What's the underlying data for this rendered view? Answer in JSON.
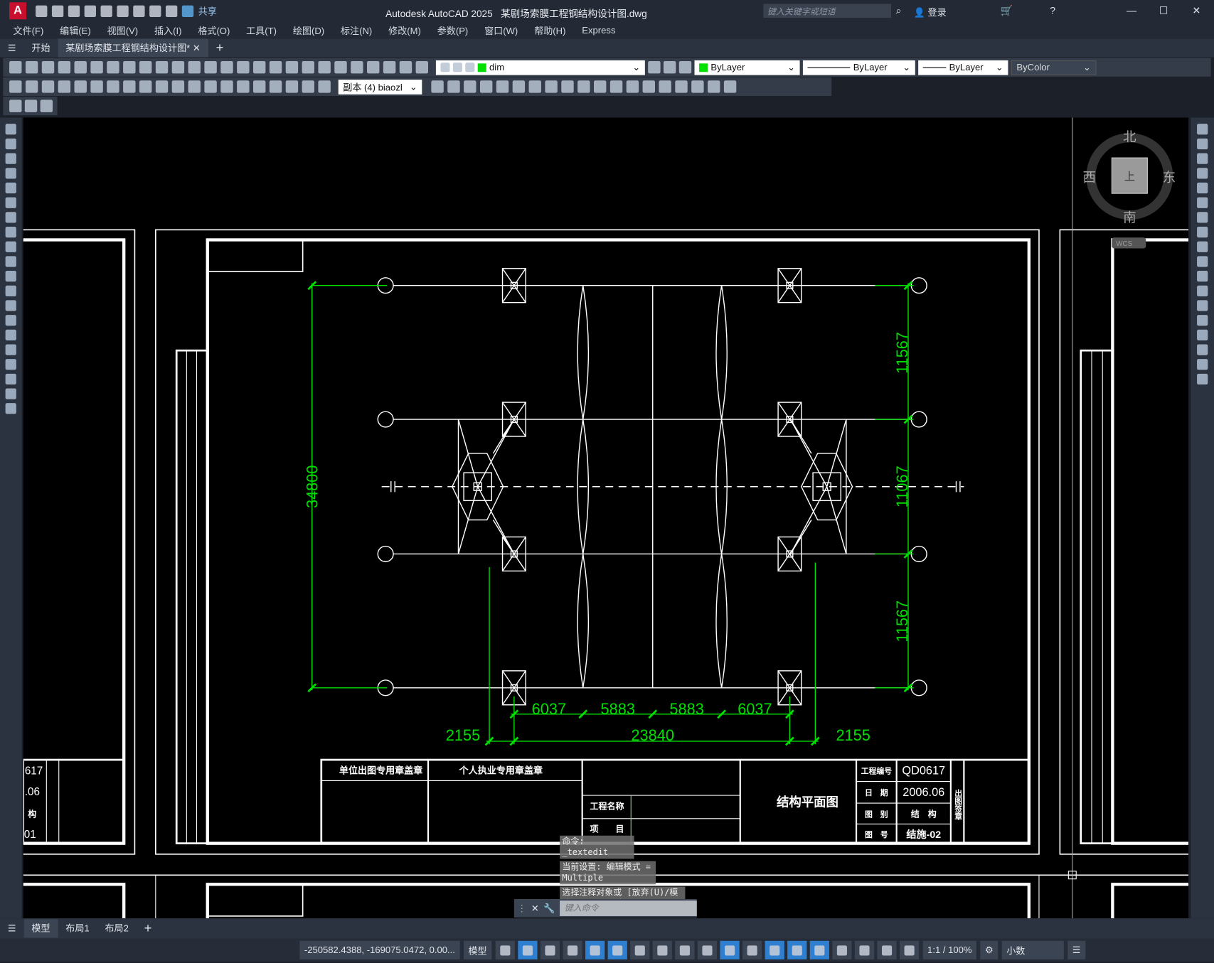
{
  "app": {
    "title": "Autodesk AutoCAD 2025",
    "file": "某剧场索膜工程钢结构设计图.dwg",
    "share": "共享",
    "search_placeholder": "键入关键字或短语",
    "login": "登录",
    "logo": "A"
  },
  "menu": [
    "文件(F)",
    "编辑(E)",
    "视图(V)",
    "插入(I)",
    "格式(O)",
    "工具(T)",
    "绘图(D)",
    "标注(N)",
    "修改(M)",
    "参数(P)",
    "窗口(W)",
    "帮助(H)",
    "Express"
  ],
  "tabs": {
    "start": "开始",
    "active": "某剧场索膜工程钢结构设计图*"
  },
  "toolbar": {
    "layer": "dim",
    "color": "ByLayer",
    "linetype": "ByLayer",
    "lineweight": "ByLayer",
    "plotstyle": "ByColor",
    "dimstyle": "副本 (4) biaozl"
  },
  "drawing": {
    "dims_vertical": {
      "total": "34800",
      "segments": [
        "11567",
        "11067",
        "11567"
      ]
    },
    "dims_bottom_top": [
      "6037",
      "5883",
      "5883",
      "6037"
    ],
    "dims_bottom": [
      "2155",
      "23840",
      "2155"
    ],
    "title_block": {
      "unit_stamp": "单位出图专用章盖章",
      "personal_stamp": "个人执业专用章盖章",
      "project_name_label": "工程名称",
      "item_label": "项　　目",
      "drawing_title": "结构平面图",
      "project_no_label": "工程编号",
      "project_no": "QD0617",
      "date_label": "日　期",
      "date": "2006.06",
      "category_label": "图　别",
      "category": "结　构",
      "drawing_no_label": "图　号",
      "drawing_no": "结施-02",
      "out_stamp": "出图签章"
    },
    "left_partial": [
      "617",
      ".06",
      "构",
      "01"
    ],
    "compass": {
      "north": "北",
      "south": "南",
      "east": "东",
      "west": "西",
      "wcs": "WCS",
      "top": "上"
    }
  },
  "command": {
    "history": [
      "命令: _textedit",
      "当前设置: 编辑模式 = Multiple",
      "选择注释对象或 [放弃(U)/模式(M)]: *取消*"
    ],
    "placeholder": "键入命令"
  },
  "layouts": [
    "模型",
    "布局1",
    "布局2"
  ],
  "status": {
    "coords": "-250582.4388, -169075.0472, 0.00...",
    "model": "模型",
    "scale": "1:1 / 100%",
    "units": "小数"
  }
}
